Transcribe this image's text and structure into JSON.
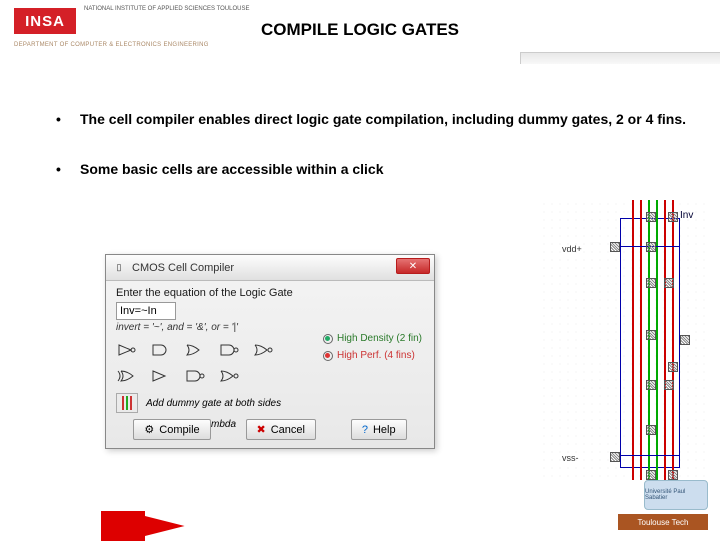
{
  "header": {
    "logo": "INSA",
    "institute": "NATIONAL INSTITUTE\nOF APPLIED\nSCIENCES\nTOULOUSE",
    "department": "DEPARTMENT OF COMPUTER & ELECTRONICS\nENGINEERING",
    "title": "COMPILE LOGIC GATES"
  },
  "bullets": [
    "The cell compiler enables direct logic gate compilation, including dummy gates, 2 or 4 fins.",
    "Some basic cells are accessible within a click"
  ],
  "dialog": {
    "title": "CMOS Cell Compiler",
    "prompt": "Enter the equation of the Logic Gate",
    "input_value": "Inv=~In",
    "hint": "invert = '~', and = '&', or = '|'",
    "radio_hd": "High Density (2 fin)",
    "radio_hp": "High Perf. (4 fins)",
    "dummy_label": "Add dummy gate at both sides",
    "route_label": "Rout path: 8 lambda",
    "btn_compile": "Compile",
    "btn_cancel": "Cancel",
    "btn_help": "Help"
  },
  "layout": {
    "vdd": "vdd+",
    "vss": "vss-",
    "cell": "Inv"
  },
  "footer": {
    "ups": "Université Paul Sabatier",
    "tt": "Toulouse Tech"
  }
}
